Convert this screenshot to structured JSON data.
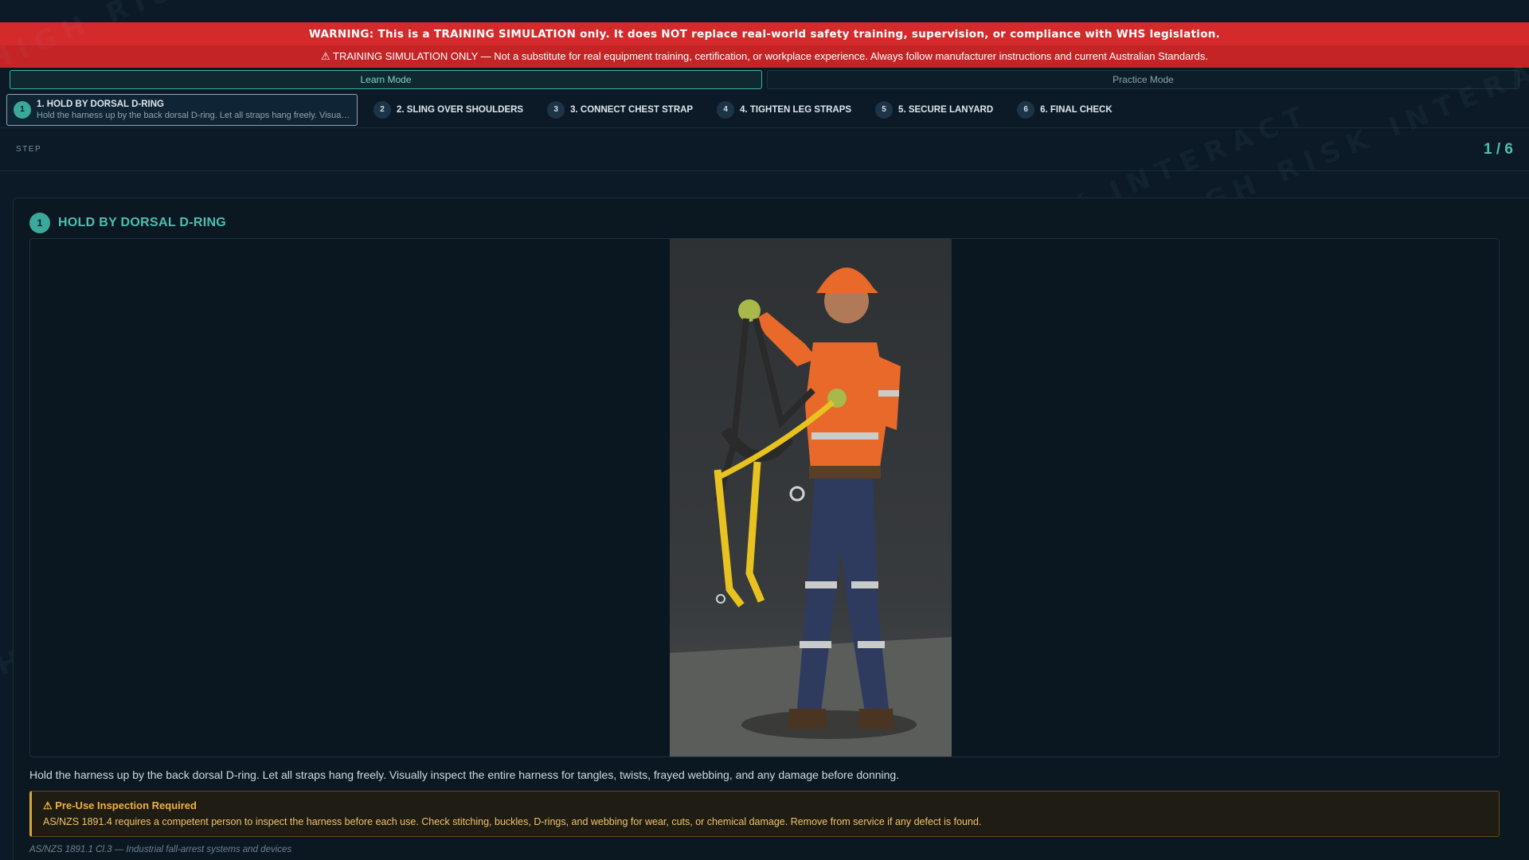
{
  "banner": {
    "warning": "WARNING: This is a TRAINING SIMULATION only. It does NOT replace real-world safety training, supervision, or compliance with WHS legislation.",
    "notice": "⚠ TRAINING SIMULATION ONLY — Not a substitute for real equipment training, certification, or workplace experience. Always follow manufacturer instructions and current Australian Standards."
  },
  "modes": {
    "learn": "Learn Mode",
    "practice": "Practice Mode",
    "active": "learn"
  },
  "steps": [
    {
      "num": "1",
      "label": "1. HOLD BY DORSAL D-RING",
      "desc": "Hold the harness up by the back dorsal D-ring. Let all straps hang freely. Visually inspect the entire harness for tangles, twists, frayed webbing, and any damage before donning."
    },
    {
      "num": "2",
      "label": "2. SLING OVER SHOULDERS"
    },
    {
      "num": "3",
      "label": "3. CONNECT CHEST STRAP"
    },
    {
      "num": "4",
      "label": "4. TIGHTEN LEG STRAPS"
    },
    {
      "num": "5",
      "label": "5. SECURE LANYARD"
    },
    {
      "num": "6",
      "label": "6. FINAL CHECK"
    }
  ],
  "counter": {
    "label": "STEP",
    "value": "1 / 6"
  },
  "panel": {
    "num": "1",
    "title": "HOLD BY DORSAL D-RING",
    "description": "Hold the harness up by the back dorsal D-ring. Let all straps hang freely. Visually inspect the entire harness for tangles, twists, frayed webbing, and any damage before donning.",
    "callout_title": "⚠ Pre-Use Inspection Required",
    "callout_text": "AS/NZS 1891.4 requires a competent person to inspect the harness before each use. Check stitching, buckles, D-rings, and webbing for wear, cuts, or chemical damage. Remove from service if any defect is found.",
    "footnote": "AS/NZS 1891.1 Cl.3 — Industrial fall-arrest systems and devices"
  },
  "watermark": {
    "repeat": "HIGH RISK INTERACT",
    "large_high": "HIGH",
    "large_risk": "RISK",
    "large_interactive": "INTERACTIVE"
  },
  "colors": {
    "accent": "#3aa89a",
    "warning_red": "#d42a2c",
    "callout_amber": "#f1b13e",
    "background": "#0c1a27"
  }
}
